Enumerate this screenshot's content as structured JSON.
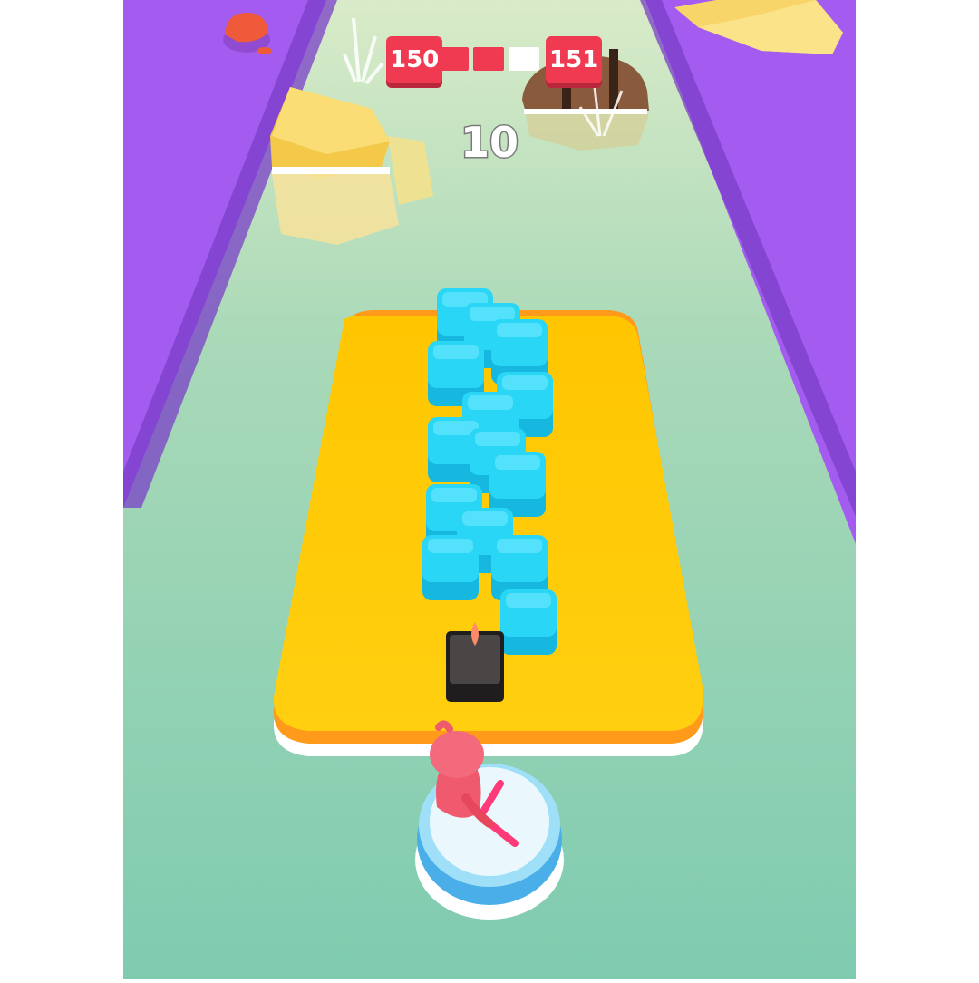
{
  "hud": {
    "current_level": "150",
    "next_level": "151",
    "level_progress": {
      "segments_total": 3,
      "segments_done": 2
    },
    "score": "10"
  },
  "colors": {
    "side_wall": "#a45cf0",
    "track": "#8ecdb5",
    "platform": "#ffc400",
    "cube": "#2ad6f5",
    "player": "#f05a6e",
    "hud_red": "#ef3a52"
  },
  "scene": {
    "cube_count": 14,
    "obstacle": "dark-stone-block",
    "player": "pink-stickman-with-pickaxe",
    "decor": [
      "yellow-rock",
      "treasure-chest",
      "crystal-plant",
      "red-mushroom"
    ]
  }
}
